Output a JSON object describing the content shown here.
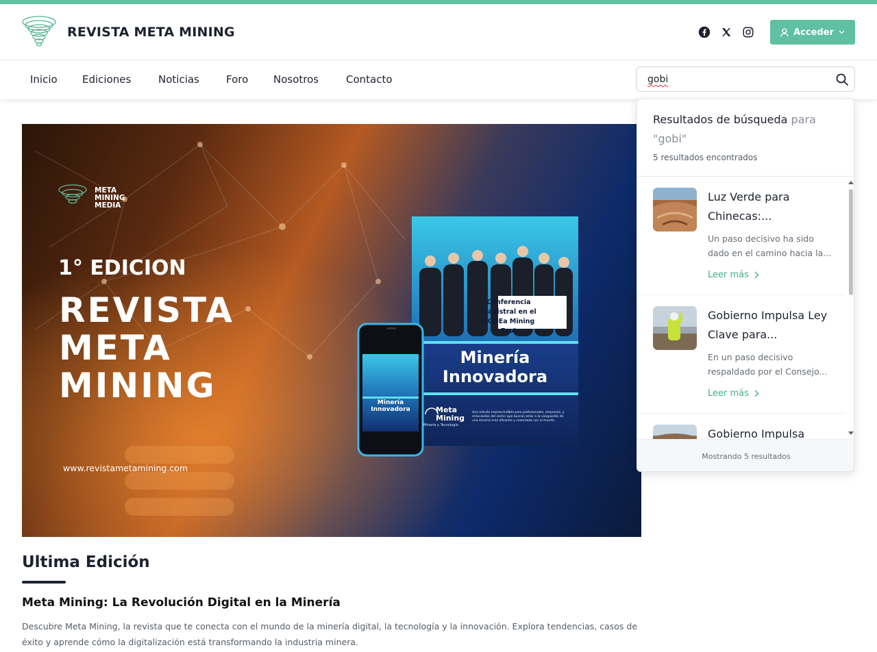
{
  "site": {
    "title": "REVISTA META MINING",
    "accent_color": "#5fc0a2"
  },
  "social": [
    {
      "name": "facebook-icon"
    },
    {
      "name": "x-icon"
    },
    {
      "name": "instagram-icon"
    }
  ],
  "auth": {
    "login_label": "Acceder"
  },
  "nav": {
    "items": [
      "Inicio",
      "Ediciones",
      "Noticias",
      "Foro",
      "Nosotros",
      "Contacto"
    ]
  },
  "search": {
    "value": "gobi"
  },
  "hero": {
    "brand_line1": "META",
    "brand_line2": "MINING",
    "brand_line3": "MEDIA",
    "edition": "1° EDICION",
    "headline1": "REVISTA",
    "headline2": "META",
    "headline3": "MINING",
    "url": "www.revistametamining.com",
    "cover_conference_line1": "Conferencia",
    "cover_conference_line2": "magistral en el",
    "cover_conference_line3": "CODEa Mining Fest",
    "cover_title1": "Minería",
    "cover_title2": "Innovadora",
    "cover_brand1": "Meta",
    "cover_brand2": "Mining",
    "cover_brand_sub": "Minería y Tecnología",
    "cover_blurb": "Una edición imprescindible para profesionales, empresas, y entusiastas del sector que buscan estar a la vanguardia de una minería más eficiente y conectada con el mundo.",
    "phone_title1": "Minería",
    "phone_title2": "Innovadora"
  },
  "latest": {
    "section_title": "Ultima Edición",
    "article_title": "Meta Mining: La Revolución Digital en la Minería",
    "article_desc": "Descubre Meta Mining, la revista que te conecta con el mundo de la minería digital, la tecnología y la innovación. Explora tendencias, casos de éxito y aprende cómo la digitalización está transformando la industria minera."
  },
  "search_results": {
    "title": "Resultados de búsqueda",
    "title_pre": "para",
    "query": "\"gobi\"",
    "count": "5 resultados encontrados",
    "footer": "Mostrando 5 resultados",
    "items": [
      {
        "title": "Luz Verde para Chinecas:...",
        "desc": "Un paso decisivo ha sido dado en el camino hacia la...",
        "more": "Leer más"
      },
      {
        "title": "Gobierno Impulsa Ley Clave para...",
        "desc": "En un paso decisivo respaldado por el Consejo...",
        "more": "Leer más"
      },
      {
        "title": "Gobierno Impulsa",
        "desc": "",
        "more": ""
      }
    ]
  }
}
